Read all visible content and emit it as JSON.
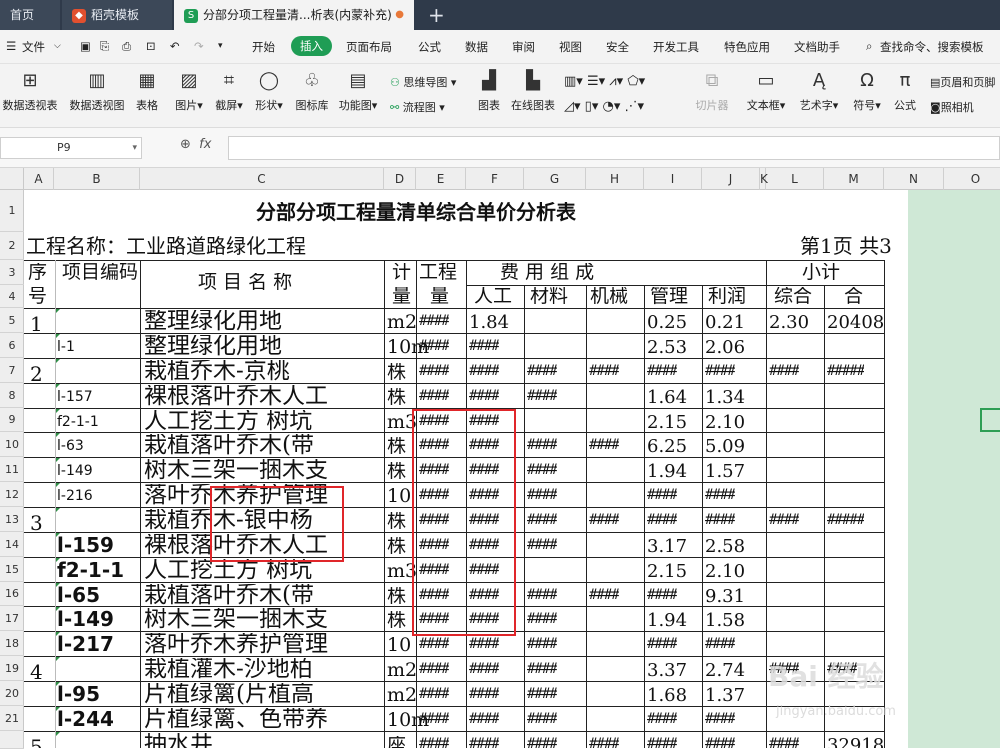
{
  "tabs": {
    "home": "首页",
    "daoke": "稻壳模板",
    "active": "分部分项工程量清...析表(内蒙补充)",
    "new": "+"
  },
  "menu": {
    "file": "文件",
    "items": [
      "开始",
      "插入",
      "页面布局",
      "公式",
      "数据",
      "审阅",
      "视图",
      "安全",
      "开发工具",
      "特色应用",
      "文档助手"
    ],
    "search": "查找命令、搜索模板"
  },
  "ribbon": {
    "pivot_table": "数据透视表",
    "pivot_chart": "数据透视图",
    "table": "表格",
    "picture": "图片",
    "screenshot": "截屏",
    "shape": "形状",
    "icon_lib": "图标库",
    "func_chart": "功能图",
    "mind_map": "思维导图",
    "flowchart": "流程图",
    "chart": "图表",
    "online_chart": "在线图表",
    "slicer": "切片器",
    "textbox": "文本框",
    "wordart": "艺术字",
    "symbol": "符号",
    "formula": "公式",
    "header_footer": "页眉和页脚",
    "camera": "照相机"
  },
  "formula_bar": {
    "cell_ref": "P9",
    "fx": "fx"
  },
  "columns": [
    "A",
    "B",
    "C",
    "D",
    "E",
    "F",
    "G",
    "H",
    "I",
    "J",
    "K",
    "L",
    "M",
    "N",
    "O"
  ],
  "rows": [
    "1",
    "2",
    "3",
    "4",
    "5",
    "6",
    "7",
    "8",
    "9",
    "10",
    "11",
    "12",
    "13",
    "14",
    "15",
    "16",
    "17",
    "18",
    "19",
    "20",
    "21",
    ""
  ],
  "sheet": {
    "title": "分部分项工程量清单综合单价分析表",
    "project_label": "工程名称：工业路道路绿化工程",
    "page_info": "第1页  共3",
    "headers": {
      "seq": "序号",
      "code": "项目编码",
      "name": "项 目 名 称",
      "unit": "计量",
      "qty": "工程量",
      "cost_group": "费     用     组     成",
      "subtotal": "小计",
      "labor": "人工",
      "material": "材料",
      "machine": "机械",
      "mgmt": "管理",
      "profit": "利润",
      "combined": "综合",
      "total": "合"
    },
    "data_rows": [
      {
        "seq": "1",
        "code": "",
        "name": "整理绿化用地",
        "unit": "m2",
        "qty": "####",
        "labor": "1.84",
        "material": "",
        "machine": "",
        "mgmt": "0.25",
        "profit": "0.21",
        "combined": "2.30",
        "total": "20408"
      },
      {
        "seq": "",
        "code": "l-1",
        "name": "整理绿化用地",
        "unit": "10m",
        "qty": "####",
        "labor": "####",
        "material": "",
        "machine": "",
        "mgmt": "2.53",
        "profit": "2.06",
        "combined": "",
        "total": ""
      },
      {
        "seq": "2",
        "code": "",
        "name": "栽植乔木-京桃",
        "unit": "株",
        "qty": "####",
        "labor": "####",
        "material": "####",
        "machine": "####",
        "mgmt": "####",
        "profit": "####",
        "combined": "####",
        "total": "#####"
      },
      {
        "seq": "",
        "code": "l-157",
        "name": "裸根落叶乔木人工",
        "unit": "株",
        "qty": "####",
        "labor": "####",
        "material": "####",
        "machine": "",
        "mgmt": "1.64",
        "profit": "1.34",
        "combined": "",
        "total": ""
      },
      {
        "seq": "",
        "code": "f2-1-1",
        "name": "人工挖土方 树坑",
        "unit": "m3",
        "qty": "####",
        "labor": "####",
        "material": "",
        "machine": "",
        "mgmt": "2.15",
        "profit": "2.10",
        "combined": "",
        "total": ""
      },
      {
        "seq": "",
        "code": "l-63",
        "name": "栽植落叶乔木(带",
        "unit": "株",
        "qty": "####",
        "labor": "####",
        "material": "####",
        "machine": "####",
        "mgmt": "6.25",
        "profit": "5.09",
        "combined": "",
        "total": ""
      },
      {
        "seq": "",
        "code": "l-149",
        "name": "树木三架一捆木支",
        "unit": "株",
        "qty": "####",
        "labor": "####",
        "material": "####",
        "machine": "",
        "mgmt": "1.94",
        "profit": "1.57",
        "combined": "",
        "total": ""
      },
      {
        "seq": "",
        "code": "l-216",
        "name": "落叶乔木养护管理",
        "unit": "10",
        "qty": "####",
        "labor": "####",
        "material": "####",
        "machine": "",
        "mgmt": "####",
        "profit": "####",
        "combined": "",
        "total": ""
      },
      {
        "seq": "3",
        "code": "",
        "name": "栽植乔木-银中杨",
        "unit": "株",
        "qty": "####",
        "labor": "####",
        "material": "####",
        "machine": "####",
        "mgmt": "####",
        "profit": "####",
        "combined": "####",
        "total": "#####"
      },
      {
        "seq": "",
        "code": "l-159",
        "name": "裸根落叶乔木人工",
        "unit": "株",
        "qty": "####",
        "labor": "####",
        "material": "####",
        "machine": "",
        "mgmt": "3.17",
        "profit": "2.58",
        "combined": "",
        "total": ""
      },
      {
        "seq": "",
        "code": "f2-1-1",
        "name": "人工挖土方 树坑",
        "unit": "m3",
        "qty": "####",
        "labor": "####",
        "material": "",
        "machine": "",
        "mgmt": "2.15",
        "profit": "2.10",
        "combined": "",
        "total": ""
      },
      {
        "seq": "",
        "code": "l-65",
        "name": "栽植落叶乔木(带",
        "unit": "株",
        "qty": "####",
        "labor": "####",
        "material": "####",
        "machine": "####",
        "mgmt": "####",
        "profit": "9.31",
        "combined": "",
        "total": ""
      },
      {
        "seq": "",
        "code": "l-149",
        "name": "树木三架一捆木支",
        "unit": "株",
        "qty": "####",
        "labor": "####",
        "material": "####",
        "machine": "",
        "mgmt": "1.94",
        "profit": "1.58",
        "combined": "",
        "total": ""
      },
      {
        "seq": "",
        "code": "l-217",
        "name": "落叶乔木养护管理",
        "unit": "10",
        "qty": "####",
        "labor": "####",
        "material": "####",
        "machine": "",
        "mgmt": "####",
        "profit": "####",
        "combined": "",
        "total": ""
      },
      {
        "seq": "4",
        "code": "",
        "name": "栽植灌木-沙地柏",
        "unit": "m2",
        "qty": "####",
        "labor": "####",
        "material": "####",
        "machine": "",
        "mgmt": "3.37",
        "profit": "2.74",
        "combined": "####",
        "total": "####"
      },
      {
        "seq": "",
        "code": "l-95",
        "name": "片植绿篱(片植高",
        "unit": "m2",
        "qty": "####",
        "labor": "####",
        "material": "####",
        "machine": "",
        "mgmt": "1.68",
        "profit": "1.37",
        "combined": "",
        "total": ""
      },
      {
        "seq": "",
        "code": "l-244",
        "name": "片植绿篱、色带养",
        "unit": "10m",
        "qty": "####",
        "labor": "####",
        "material": "####",
        "machine": "",
        "mgmt": "####",
        "profit": "####",
        "combined": "",
        "total": ""
      },
      {
        "seq": "5",
        "code": "",
        "name": "抽水井",
        "unit": "座",
        "qty": "####",
        "labor": "####",
        "material": "####",
        "machine": "####",
        "mgmt": "####",
        "profit": "####",
        "combined": "####",
        "total": "32918"
      }
    ]
  },
  "watermark": {
    "main": "Bai 经验",
    "sub": "jingyan.baidu.com"
  },
  "colors": {
    "accent": "#1f9d55",
    "highlight": "#e0262a",
    "pane": "#cfe8d6"
  }
}
